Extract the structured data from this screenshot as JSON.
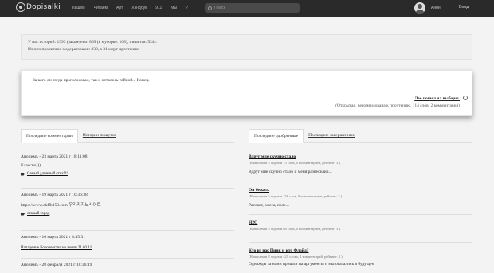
{
  "header": {
    "logo_text": "Dopisalki",
    "nav": [
      "Пишем",
      "Читаем",
      "Арт",
      "Хэндбук",
      "911",
      "Мы",
      "?"
    ],
    "search_placeholder": "Поиск",
    "user_name": "Анон",
    "login_label": "Вход"
  },
  "stats": {
    "line1": "У нас историй: 1393 (закончено: 869 (в мусорке: 108), пишется: 524).",
    "line2": "Из них прочитано модераторами: 838, а 31 ждут прочтения"
  },
  "featured": {
    "excerpt": "За кого он тогда проголосовал, так и осталось тайной... Конец.",
    "title": "Лео пошел на выборы.",
    "meta": "(Открытая, рекомендована к прочтению, 114 слов, 2 комментария)"
  },
  "left": {
    "tabs": [
      "Последние комментарии",
      "Истории пишутся"
    ],
    "items": [
      {
        "meta": "Анонимъ - 23 марта 2021 г 18:11:08",
        "text": "Классно)))",
        "link": "Самый длинный стих!!!"
      },
      {
        "meta": "Анонимъ - 19 марта 2021 г 10:36:38",
        "text": "https://www.ekffb150.com 우리카지노사이트",
        "link": "старый город"
      },
      {
        "meta": "Анонимъ - 16 марта 2021 г 8:45:31",
        "text": "",
        "link": "Нападение Королевства на земли 21.03.11"
      },
      {
        "meta": "Анонимъ - 28 февраля 2021 г 18:36:19",
        "text": "",
        "link": ""
      }
    ]
  },
  "right": {
    "tabs": [
      "Последние одобренные",
      "Последние завершенные"
    ],
    "items": [
      {
        "title": "Вдруг мне скучно стало",
        "sub": "(Написана в 5 ходов и 15 слов, 0 комментариев, рейтинг: 3 )",
        "text": "Вдруг мне скучно стало и меня развеселил..."
      },
      {
        "title": "Он бежал.",
        "sub": "(Написана в 5 ходов и 158 слов, 0 комментариев, рейтинг: 3 )",
        "text": "Рассвет, росса, поле..."
      },
      {
        "title": "H2O",
        "sub": "(Написана в 5 ходов и 68 слов, 0 комментариев, рейтинг: 3 )",
        "text": ""
      },
      {
        "title": "Кто из вас Пинк и кто Флойд?",
        "sub": "(Написана в 8 ходов и 421 слово, 1 комментарий, рейтинг: 3 )",
        "text": "Однажды за нами пришли на аргументы и мы оказались в будущем"
      }
    ]
  }
}
